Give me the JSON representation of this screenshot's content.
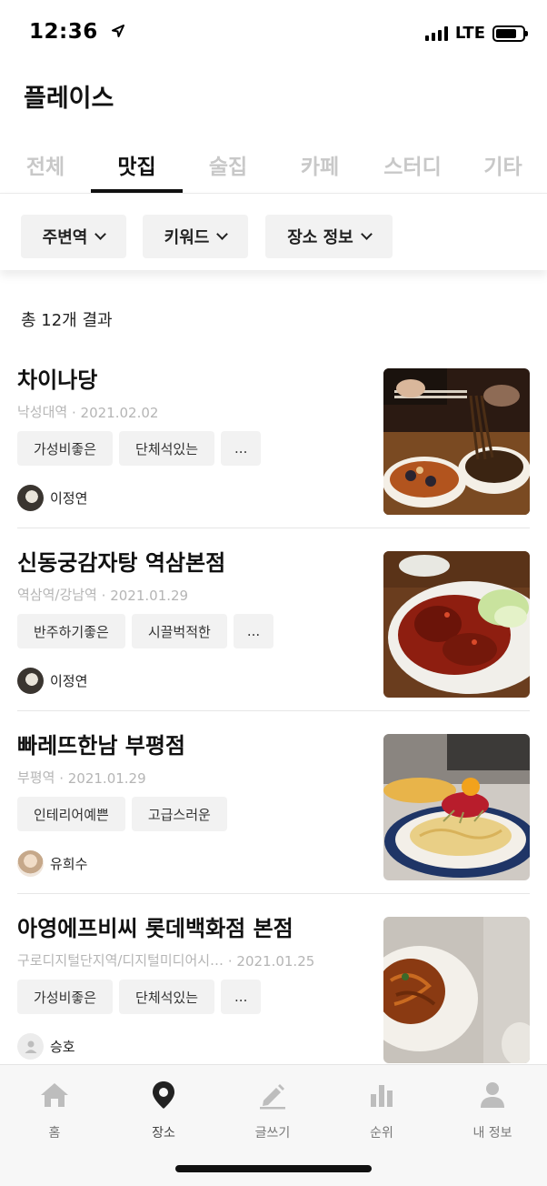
{
  "status_bar": {
    "time": "12:36",
    "network": "LTE",
    "location_icon": "location-arrow-icon"
  },
  "header": {
    "title": "플레이스"
  },
  "tabs": [
    {
      "label": "전체",
      "active": false
    },
    {
      "label": "맛집",
      "active": true
    },
    {
      "label": "술집",
      "active": false
    },
    {
      "label": "카페",
      "active": false
    },
    {
      "label": "스터디",
      "active": false
    },
    {
      "label": "기타",
      "active": false
    }
  ],
  "filters": [
    {
      "label": "주변역",
      "icon": "chevron-down-icon"
    },
    {
      "label": "키워드",
      "icon": "chevron-down-icon"
    },
    {
      "label": "장소 정보",
      "icon": "chevron-down-icon"
    }
  ],
  "results": {
    "count_text": "총 12개 결과"
  },
  "places": [
    {
      "name": "차이나당",
      "station": "낙성대역",
      "separator": "·",
      "date": "2021.02.02",
      "tags": [
        "가성비좋은",
        "단체석있는",
        "..."
      ],
      "author": "이정연",
      "avatar": "photo"
    },
    {
      "name": "신동궁감자탕 역삼본점",
      "station": "역삼역/강남역",
      "separator": "·",
      "date": "2021.01.29",
      "tags": [
        "반주하기좋은",
        "시끌벅적한",
        "..."
      ],
      "author": "이정연",
      "avatar": "photo"
    },
    {
      "name": "빠레뜨한남 부평점",
      "station": "부평역",
      "separator": "·",
      "date": "2021.01.29",
      "tags": [
        "인테리어예쁜",
        "고급스러운"
      ],
      "author": "유희수",
      "avatar": "photo"
    },
    {
      "name": "아영에프비씨 롯데백화점 본점",
      "station": "구로디지털단지역/디지털미디어시…",
      "separator": "·",
      "date": "2021.01.25",
      "tags": [
        "가성비좋은",
        "단체석있는",
        "..."
      ],
      "author": "승호",
      "avatar": "default"
    }
  ],
  "bottom_nav": [
    {
      "label": "홈",
      "icon": "home-icon",
      "active": false
    },
    {
      "label": "장소",
      "icon": "map-pin-icon",
      "active": true
    },
    {
      "label": "글쓰기",
      "icon": "pencil-icon",
      "active": false
    },
    {
      "label": "순위",
      "icon": "bar-chart-icon",
      "active": false
    },
    {
      "label": "내 정보",
      "icon": "user-icon",
      "active": false
    }
  ],
  "colors": {
    "text_primary": "#111111",
    "text_secondary": "#b5b5b5",
    "tab_inactive": "#c8c8c8",
    "chip_bg": "#f2f2f2",
    "nav_bg": "#f7f7f7",
    "nav_icon_inactive": "#bdbdbd",
    "nav_icon_active": "#222222"
  }
}
